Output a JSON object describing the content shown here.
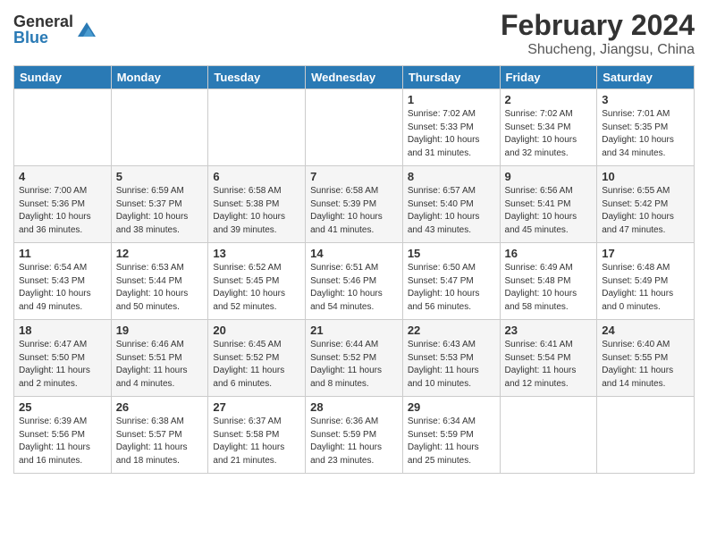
{
  "header": {
    "logo_general": "General",
    "logo_blue": "Blue",
    "title": "February 2024",
    "location": "Shucheng, Jiangsu, China"
  },
  "days_of_week": [
    "Sunday",
    "Monday",
    "Tuesday",
    "Wednesday",
    "Thursday",
    "Friday",
    "Saturday"
  ],
  "weeks": [
    [
      {
        "day": "",
        "info": ""
      },
      {
        "day": "",
        "info": ""
      },
      {
        "day": "",
        "info": ""
      },
      {
        "day": "",
        "info": ""
      },
      {
        "day": "1",
        "info": "Sunrise: 7:02 AM\nSunset: 5:33 PM\nDaylight: 10 hours\nand 31 minutes."
      },
      {
        "day": "2",
        "info": "Sunrise: 7:02 AM\nSunset: 5:34 PM\nDaylight: 10 hours\nand 32 minutes."
      },
      {
        "day": "3",
        "info": "Sunrise: 7:01 AM\nSunset: 5:35 PM\nDaylight: 10 hours\nand 34 minutes."
      }
    ],
    [
      {
        "day": "4",
        "info": "Sunrise: 7:00 AM\nSunset: 5:36 PM\nDaylight: 10 hours\nand 36 minutes."
      },
      {
        "day": "5",
        "info": "Sunrise: 6:59 AM\nSunset: 5:37 PM\nDaylight: 10 hours\nand 38 minutes."
      },
      {
        "day": "6",
        "info": "Sunrise: 6:58 AM\nSunset: 5:38 PM\nDaylight: 10 hours\nand 39 minutes."
      },
      {
        "day": "7",
        "info": "Sunrise: 6:58 AM\nSunset: 5:39 PM\nDaylight: 10 hours\nand 41 minutes."
      },
      {
        "day": "8",
        "info": "Sunrise: 6:57 AM\nSunset: 5:40 PM\nDaylight: 10 hours\nand 43 minutes."
      },
      {
        "day": "9",
        "info": "Sunrise: 6:56 AM\nSunset: 5:41 PM\nDaylight: 10 hours\nand 45 minutes."
      },
      {
        "day": "10",
        "info": "Sunrise: 6:55 AM\nSunset: 5:42 PM\nDaylight: 10 hours\nand 47 minutes."
      }
    ],
    [
      {
        "day": "11",
        "info": "Sunrise: 6:54 AM\nSunset: 5:43 PM\nDaylight: 10 hours\nand 49 minutes."
      },
      {
        "day": "12",
        "info": "Sunrise: 6:53 AM\nSunset: 5:44 PM\nDaylight: 10 hours\nand 50 minutes."
      },
      {
        "day": "13",
        "info": "Sunrise: 6:52 AM\nSunset: 5:45 PM\nDaylight: 10 hours\nand 52 minutes."
      },
      {
        "day": "14",
        "info": "Sunrise: 6:51 AM\nSunset: 5:46 PM\nDaylight: 10 hours\nand 54 minutes."
      },
      {
        "day": "15",
        "info": "Sunrise: 6:50 AM\nSunset: 5:47 PM\nDaylight: 10 hours\nand 56 minutes."
      },
      {
        "day": "16",
        "info": "Sunrise: 6:49 AM\nSunset: 5:48 PM\nDaylight: 10 hours\nand 58 minutes."
      },
      {
        "day": "17",
        "info": "Sunrise: 6:48 AM\nSunset: 5:49 PM\nDaylight: 11 hours\nand 0 minutes."
      }
    ],
    [
      {
        "day": "18",
        "info": "Sunrise: 6:47 AM\nSunset: 5:50 PM\nDaylight: 11 hours\nand 2 minutes."
      },
      {
        "day": "19",
        "info": "Sunrise: 6:46 AM\nSunset: 5:51 PM\nDaylight: 11 hours\nand 4 minutes."
      },
      {
        "day": "20",
        "info": "Sunrise: 6:45 AM\nSunset: 5:52 PM\nDaylight: 11 hours\nand 6 minutes."
      },
      {
        "day": "21",
        "info": "Sunrise: 6:44 AM\nSunset: 5:52 PM\nDaylight: 11 hours\nand 8 minutes."
      },
      {
        "day": "22",
        "info": "Sunrise: 6:43 AM\nSunset: 5:53 PM\nDaylight: 11 hours\nand 10 minutes."
      },
      {
        "day": "23",
        "info": "Sunrise: 6:41 AM\nSunset: 5:54 PM\nDaylight: 11 hours\nand 12 minutes."
      },
      {
        "day": "24",
        "info": "Sunrise: 6:40 AM\nSunset: 5:55 PM\nDaylight: 11 hours\nand 14 minutes."
      }
    ],
    [
      {
        "day": "25",
        "info": "Sunrise: 6:39 AM\nSunset: 5:56 PM\nDaylight: 11 hours\nand 16 minutes."
      },
      {
        "day": "26",
        "info": "Sunrise: 6:38 AM\nSunset: 5:57 PM\nDaylight: 11 hours\nand 18 minutes."
      },
      {
        "day": "27",
        "info": "Sunrise: 6:37 AM\nSunset: 5:58 PM\nDaylight: 11 hours\nand 21 minutes."
      },
      {
        "day": "28",
        "info": "Sunrise: 6:36 AM\nSunset: 5:59 PM\nDaylight: 11 hours\nand 23 minutes."
      },
      {
        "day": "29",
        "info": "Sunrise: 6:34 AM\nSunset: 5:59 PM\nDaylight: 11 hours\nand 25 minutes."
      },
      {
        "day": "",
        "info": ""
      },
      {
        "day": "",
        "info": ""
      }
    ]
  ]
}
